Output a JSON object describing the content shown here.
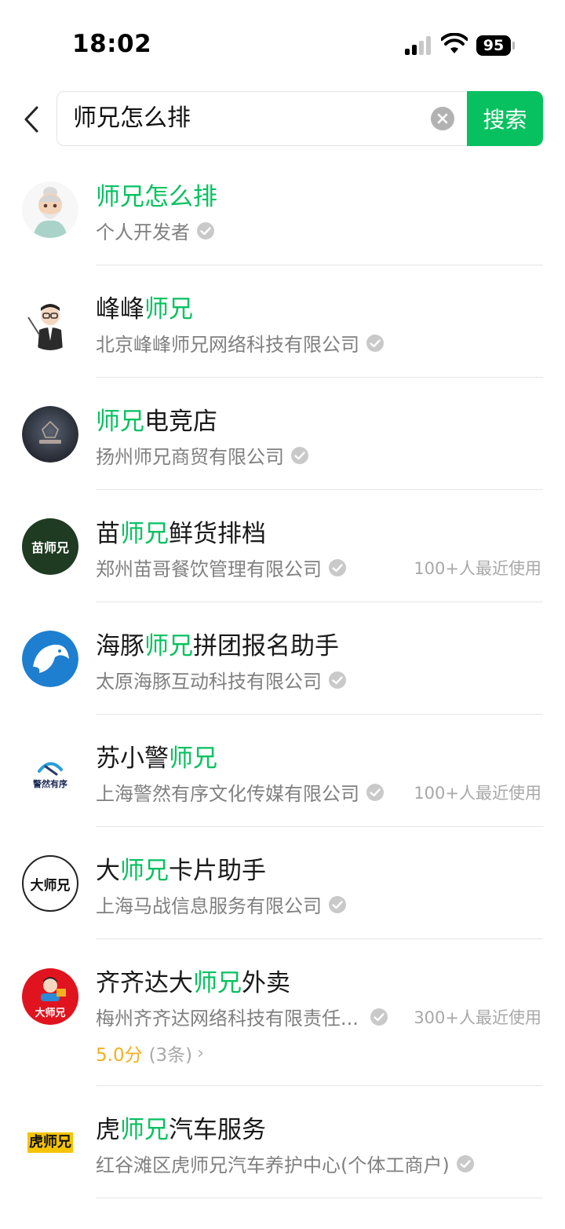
{
  "status_bar": {
    "time": "18:02",
    "battery": "95"
  },
  "search": {
    "query": "师兄怎么排",
    "button_label": "搜索"
  },
  "colors": {
    "accent": "#07c160",
    "rating": "#f0b020"
  },
  "results": [
    {
      "name_pre": "",
      "name_hl": "师兄怎么排",
      "name_post": "",
      "subtitle": "个人开发者",
      "usage": "",
      "avatar": "old-master-cartoon"
    },
    {
      "name_pre": "峰峰",
      "name_hl": "师兄",
      "name_post": "",
      "subtitle": "北京峰峰师兄网络科技有限公司",
      "usage": "",
      "avatar": "teacher-cartoon"
    },
    {
      "name_pre": "",
      "name_hl": "师兄",
      "name_post": "电竞店",
      "subtitle": "扬州师兄商贸有限公司",
      "usage": "",
      "avatar": "esports-logo"
    },
    {
      "name_pre": "苗",
      "name_hl": "师兄",
      "name_post": "鲜货排档",
      "subtitle": "郑州苗哥餐饮管理有限公司",
      "usage": "100+人最近使用",
      "avatar": "miao-shixiong-logo",
      "avatar_text": "苗师兄"
    },
    {
      "name_pre": "海豚",
      "name_hl": "师兄",
      "name_post": "拼团报名助手",
      "subtitle": "太原海豚互动科技有限公司",
      "usage": "",
      "avatar": "dolphin-logo"
    },
    {
      "name_pre": "苏小警",
      "name_hl": "师兄",
      "name_post": "",
      "subtitle": "上海警然有序文化传媒有限公司",
      "usage": "100+人最近使用",
      "avatar": "jingran-logo",
      "avatar_text": "警然有序"
    },
    {
      "name_pre": "大",
      "name_hl": "师兄",
      "name_post": "卡片助手",
      "subtitle": "上海马战信息服务有限公司",
      "usage": "",
      "avatar": "da-shixiong-logo",
      "avatar_text": "大师兄"
    },
    {
      "name_pre": "齐齐达大",
      "name_hl": "师兄",
      "name_post": "外卖",
      "subtitle": "梅州齐齐达网络科技有限责任...",
      "usage": "300+人最近使用",
      "avatar": "delivery-rider-logo",
      "avatar_text": "大师兄",
      "rating": "5.0分",
      "rating_count": "(3条)"
    },
    {
      "name_pre": "虎",
      "name_hl": "师兄",
      "name_post": "汽车服务",
      "subtitle": "红谷滩区虎师兄汽车养护中心(个体工商户)",
      "usage": "",
      "avatar": "hu-shixiong-logo",
      "avatar_text": "虎师兄"
    }
  ]
}
